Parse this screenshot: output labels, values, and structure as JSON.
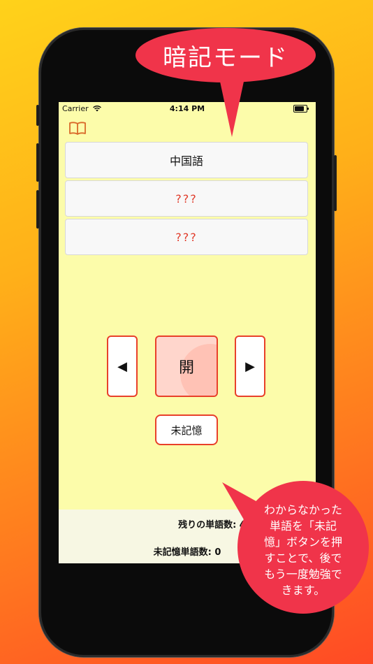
{
  "status": {
    "carrier": "Carrier",
    "time": "4:14 PM"
  },
  "card": {
    "word": "中国語",
    "hidden1": "???",
    "hidden2": "???"
  },
  "controls": {
    "prev": "◀",
    "open": "開",
    "next": "▶",
    "unmemorized": "未記憶"
  },
  "footer": {
    "remaining": "残りの単語数: 49",
    "unmemorized_count": "未記憶単語数: 0"
  },
  "callouts": {
    "top": "暗記モード",
    "bottom": [
      "わからなかった",
      "単語を「未記",
      "憶」ボタンを押",
      "すことで、後で",
      "もう一度勉強で",
      "きます。"
    ]
  },
  "colors": {
    "accent": "#e8402a",
    "callout": "#f0344a",
    "screen_bg": "#fcfcaa",
    "book_icon": "#d9692a"
  },
  "icons": {
    "menu": "book-icon"
  }
}
